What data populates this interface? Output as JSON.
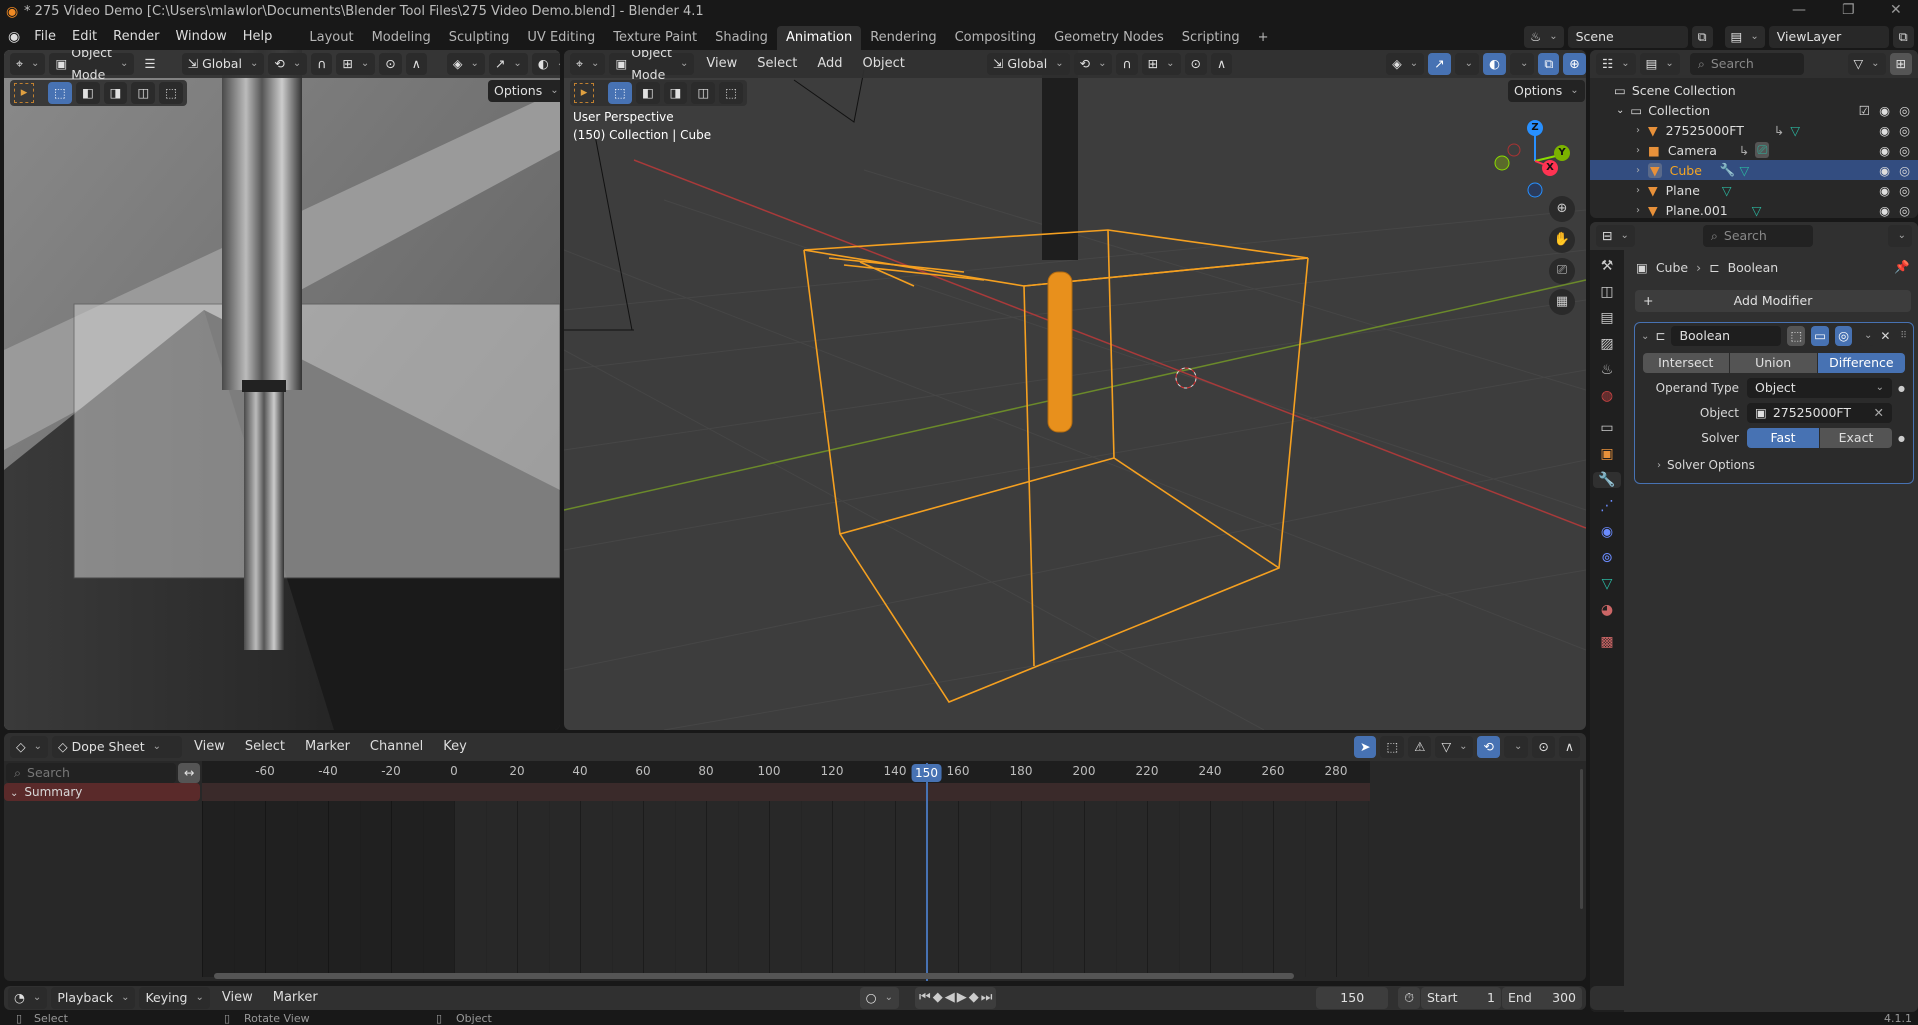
{
  "window": {
    "title": "* 275 Video Demo [C:\\Users\\mlawlor\\Documents\\Blender Tool Files\\275 Video Demo.blend] - Blender 4.1",
    "controls": [
      "minimize-icon",
      "maximize-icon",
      "close-icon"
    ]
  },
  "menubar": {
    "items": [
      "File",
      "Edit",
      "Render",
      "Window",
      "Help"
    ]
  },
  "workspaces": {
    "tabs": [
      "Layout",
      "Modeling",
      "Sculpting",
      "UV Editing",
      "Texture Paint",
      "Shading",
      "Animation",
      "Rendering",
      "Compositing",
      "Geometry Nodes",
      "Scripting"
    ],
    "active": "Animation",
    "add_label": "+"
  },
  "scene_selector": {
    "scene": "Scene",
    "view_layer": "ViewLayer"
  },
  "render_view": {
    "mode": "Object Mode",
    "orientation": "Global",
    "options_label": "Options"
  },
  "viewport": {
    "mode": "Object Mode",
    "menus": [
      "View",
      "Select",
      "Add",
      "Object"
    ],
    "orientation": "Global",
    "options_label": "Options",
    "overlay_title": "User Perspective",
    "overlay_context": "(150) Collection | Cube",
    "gizmo_axes": {
      "x": "X",
      "y": "Y",
      "z": "Z"
    },
    "colors": {
      "selection": "#f5a623",
      "x_axis": "#ff3352",
      "y_axis": "#8bdc00",
      "z_axis": "#2890ff"
    }
  },
  "outliner": {
    "search_placeholder": "Search",
    "scene_collection": "Scene Collection",
    "collection": "Collection",
    "items": [
      {
        "name": "27525000FT",
        "type": "mesh",
        "selected": false
      },
      {
        "name": "Camera",
        "type": "camera",
        "selected": false
      },
      {
        "name": "Cube",
        "type": "mesh",
        "selected": true
      },
      {
        "name": "Plane",
        "type": "mesh",
        "selected": false
      },
      {
        "name": "Plane.001",
        "type": "mesh",
        "selected": false
      }
    ]
  },
  "properties": {
    "search_placeholder": "Search",
    "breadcrumb": [
      "Cube",
      "Boolean"
    ],
    "add_modifier_label": "Add Modifier",
    "modifier": {
      "name": "Boolean",
      "operations": [
        "Intersect",
        "Union",
        "Difference"
      ],
      "active_operation": "Difference",
      "operand_type_label": "Operand Type",
      "operand_type": "Object",
      "object_label": "Object",
      "object": "27525000FT",
      "solver_label": "Solver",
      "solvers": [
        "Fast",
        "Exact"
      ],
      "active_solver": "Fast",
      "solver_options_label": "Solver Options"
    }
  },
  "dopesheet": {
    "mode": "Dope Sheet",
    "menus": [
      "View",
      "Select",
      "Marker",
      "Channel",
      "Key"
    ],
    "search_placeholder": "Search",
    "summary_label": "Summary",
    "ruler_ticks": [
      -60,
      -40,
      -20,
      0,
      20,
      40,
      60,
      80,
      100,
      120,
      140,
      160,
      180,
      200,
      220,
      240,
      260,
      280
    ],
    "current_frame": 150
  },
  "timeline": {
    "menus": [
      "Playback",
      "Keying",
      "View",
      "Marker"
    ],
    "current_frame": "150",
    "start_label": "Start",
    "start": "1",
    "end_label": "End",
    "end": "300"
  },
  "statusbar": {
    "hints": [
      "Select",
      "Rotate View",
      "Object"
    ],
    "version": "4.1.1"
  }
}
